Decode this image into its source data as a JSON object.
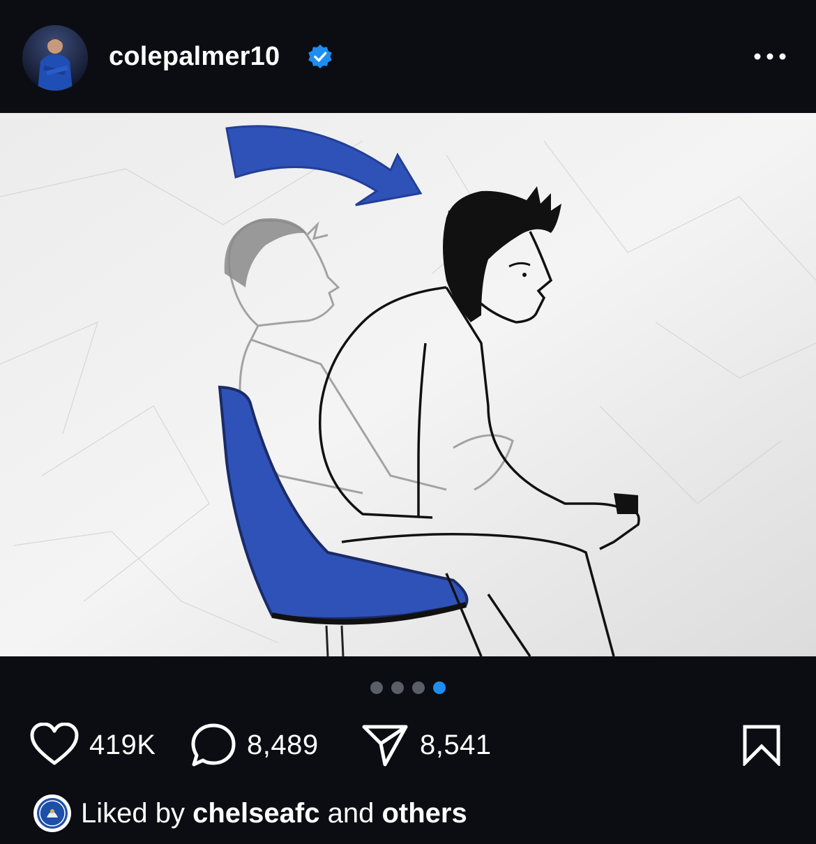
{
  "post": {
    "username": "colepalmer10",
    "verified": true,
    "likes": "419K",
    "comments": "8,489",
    "shares": "8,541",
    "carousel": {
      "total": 4,
      "active": 4
    },
    "liked_by": {
      "prefix": "Liked by",
      "user": "chelseafc",
      "middle": "and",
      "others": "others"
    }
  },
  "colors": {
    "background": "#0b0d12",
    "verified_badge": "#1d8ef0",
    "active_dot": "#1d8ef0",
    "chair_blue": "#2f52b8"
  },
  "icons": [
    "more-icon",
    "heart-icon",
    "comment-icon",
    "share-icon",
    "bookmark-icon",
    "verified-badge-icon"
  ]
}
